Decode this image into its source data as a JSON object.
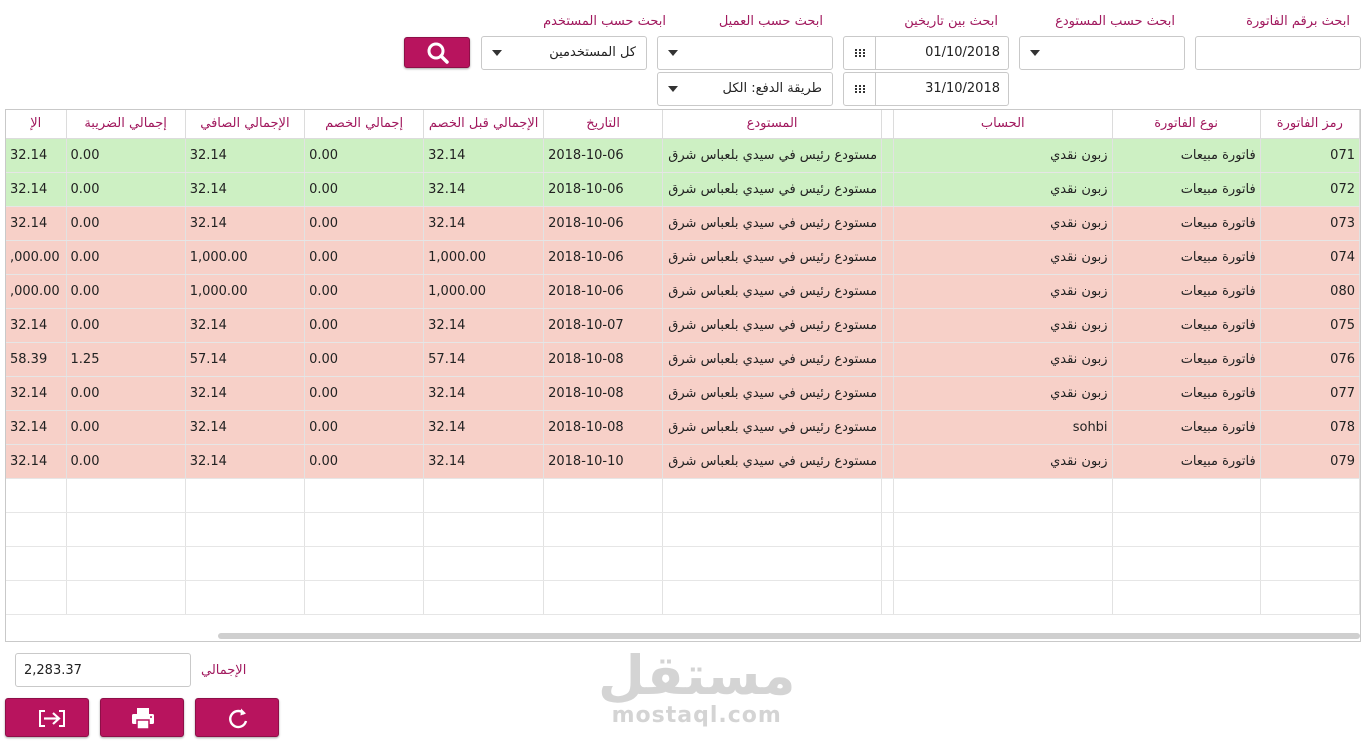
{
  "filters": {
    "invoice_number": {
      "label": "ابحث برقم الفاتورة",
      "value": ""
    },
    "warehouse": {
      "label": "ابحث حسب المستودع",
      "value": ""
    },
    "date_range": {
      "label": "ابحث بين تاريخين",
      "from": "01/10/2018",
      "to": "31/10/2018"
    },
    "customer": {
      "label": "ابحث حسب العميل",
      "value": ""
    },
    "payment_method": {
      "value": "طريقة الدفع: الكل"
    },
    "user": {
      "label": "ابحث حسب المستخدم",
      "value": "كل المستخدمين"
    }
  },
  "colors": {
    "accent": "#b8145e",
    "label": "#a1195e",
    "paid_row": "#cdf0c3",
    "unpaid_row": "#f7d0c8"
  },
  "icons": {
    "search": "search-icon",
    "calendar": "calendar-icon",
    "exit": "exit-icon",
    "print": "print-icon",
    "refresh": "refresh-icon"
  },
  "table": {
    "columns": [
      "رمز الفاتورة",
      "نوع الفاتورة",
      "الحساب",
      "",
      "المستودع",
      "التاريخ",
      "الإجمالي قبل الخصم",
      "إجمالي الخصم",
      "الإجمالي الصافي",
      "إجمالي الضريبة",
      "الإ"
    ],
    "rows": [
      {
        "status": "paid",
        "cells": [
          "071",
          "فاتورة مبيعات",
          "زبون نقدي",
          "",
          "مستودع رئيس في سيدي بلعباس شرق",
          "2018-10-06",
          "32.14",
          "0.00",
          "32.14",
          "0.00",
          "32.14"
        ]
      },
      {
        "status": "paid",
        "cells": [
          "072",
          "فاتورة مبيعات",
          "زبون نقدي",
          "",
          "مستودع رئيس في سيدي بلعباس شرق",
          "2018-10-06",
          "32.14",
          "0.00",
          "32.14",
          "0.00",
          "32.14"
        ]
      },
      {
        "status": "unpaid",
        "cells": [
          "073",
          "فاتورة مبيعات",
          "زبون نقدي",
          "",
          "مستودع رئيس في سيدي بلعباس شرق",
          "2018-10-06",
          "32.14",
          "0.00",
          "32.14",
          "0.00",
          "32.14"
        ]
      },
      {
        "status": "unpaid",
        "cells": [
          "074",
          "فاتورة مبيعات",
          "زبون نقدي",
          "",
          "مستودع رئيس في سيدي بلعباس شرق",
          "2018-10-06",
          "1,000.00",
          "0.00",
          "1,000.00",
          "0.00",
          ",000.00"
        ]
      },
      {
        "status": "unpaid",
        "cells": [
          "080",
          "فاتورة مبيعات",
          "زبون نقدي",
          "",
          "مستودع رئيس في سيدي بلعباس شرق",
          "2018-10-06",
          "1,000.00",
          "0.00",
          "1,000.00",
          "0.00",
          ",000.00"
        ]
      },
      {
        "status": "unpaid",
        "cells": [
          "075",
          "فاتورة مبيعات",
          "زبون نقدي",
          "",
          "مستودع رئيس في سيدي بلعباس شرق",
          "2018-10-07",
          "32.14",
          "0.00",
          "32.14",
          "0.00",
          "32.14"
        ]
      },
      {
        "status": "unpaid",
        "cells": [
          "076",
          "فاتورة مبيعات",
          "زبون نقدي",
          "",
          "مستودع رئيس في سيدي بلعباس شرق",
          "2018-10-08",
          "57.14",
          "0.00",
          "57.14",
          "1.25",
          "58.39"
        ]
      },
      {
        "status": "unpaid",
        "cells": [
          "077",
          "فاتورة مبيعات",
          "زبون نقدي",
          "",
          "مستودع رئيس في سيدي بلعباس شرق",
          "2018-10-08",
          "32.14",
          "0.00",
          "32.14",
          "0.00",
          "32.14"
        ]
      },
      {
        "status": "unpaid",
        "cells": [
          "078",
          "فاتورة مبيعات",
          "sohbi",
          "",
          "مستودع رئيس في سيدي بلعباس شرق",
          "2018-10-08",
          "32.14",
          "0.00",
          "32.14",
          "0.00",
          "32.14"
        ]
      },
      {
        "status": "unpaid",
        "cells": [
          "079",
          "فاتورة مبيعات",
          "زبون نقدي",
          "",
          "مستودع رئيس في سيدي بلعباس شرق",
          "2018-10-10",
          "32.14",
          "0.00",
          "32.14",
          "0.00",
          "32.14"
        ]
      }
    ],
    "empty_row_count": 4
  },
  "footer": {
    "total_label": "الإجمالي",
    "total_value": "2,283.37"
  },
  "watermark": {
    "arabic": "مستقل",
    "latin": "mostaql.com"
  }
}
